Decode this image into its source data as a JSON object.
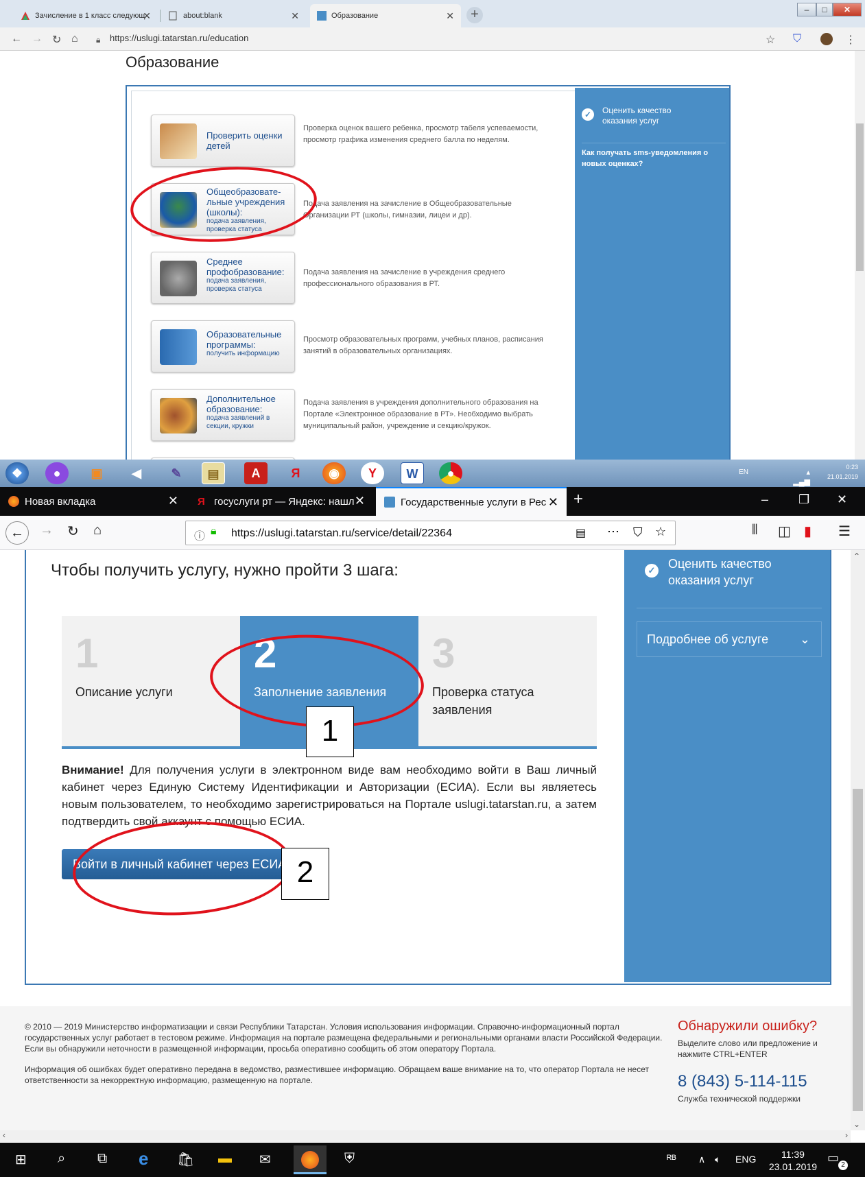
{
  "chrome": {
    "tabs": [
      {
        "label": "Зачисление в 1 класс следующ"
      },
      {
        "label": "about:blank"
      },
      {
        "label": "Образование"
      }
    ],
    "new_tab": "+",
    "url": "https://uslugi.tatarstan.ru/education"
  },
  "education": {
    "title": "Образование",
    "rate_label": "Оценить качество оказания услуг",
    "sms_link": "Как получать sms-уведомления о новых оценках?",
    "services": [
      {
        "title": "Проверить оценки детей",
        "sub": "",
        "desc": "Проверка оценок вашего ребенка, просмотр табеля успеваемости, просмотр графика изменения среднего балла по неделям."
      },
      {
        "title": "Общеобразовате-льные учреждения (школы):",
        "sub": "подача заявления, проверка статуса",
        "desc": "Подача заявления на зачисление в Общеобразовательные Организации РТ (школы, гимназии, лицеи и др)."
      },
      {
        "title": "Среднее профобразование:",
        "sub": "подача заявления, проверка статуса",
        "desc": "Подача заявления на зачисление в учреждения среднего профессионального образования в РТ."
      },
      {
        "title": "Образовательные программы:",
        "sub": "получить информацию",
        "desc": "Просмотр образовательных программ, учебных планов, расписания занятий в образовательных организациях."
      },
      {
        "title": "Дополнительное образование:",
        "sub": "подача заявлений в секции, кружки",
        "desc": "Подача заявления в учреждения дополнительного образования на Портале «Электронное образование в РТ». Необходимо выбрать муниципальный район, учреждение и секцию/кружок."
      }
    ]
  },
  "win7": {
    "lang": "EN",
    "time": "0:23",
    "date": "21.01.2019"
  },
  "firefox": {
    "tabs": [
      {
        "label": "Новая вкладка"
      },
      {
        "label": "госуслуги рт — Яндекс: нашл"
      },
      {
        "label": "Государственные услуги в Рес"
      }
    ],
    "new_tab": "+",
    "url": "https://uslugi.tatarstan.ru/service/detail/22364"
  },
  "service": {
    "heading": "Чтобы получить услугу, нужно пройти 3 шага:",
    "steps": [
      {
        "num": "1",
        "label": "Описание услуги"
      },
      {
        "num": "2",
        "label": "Заполнение заявления"
      },
      {
        "num": "3",
        "label": "Проверка статуса заявления"
      }
    ],
    "warning_bold": "Внимание!",
    "warning_text": " Для получения услуги в электронном виде вам необходимо войти в Ваш личный кабинет через Единую Систему Идентификации и Авторизации (ЕСИА). Если вы являетесь новым пользователем, то необходимо зарегистрироваться на Портале uslugi.tatarstan.ru, а затем подтвердить свой аккаунт с помощью ЕСИА.",
    "esia_button": "Войти в личный кабинет через ЕСИА",
    "rate_label": "Оценить качество оказания услуг",
    "more_label": "Подробнее об услуге"
  },
  "footer": {
    "para1": "© 2010 — 2019 Министерство информатизации и связи Республики Татарстан. Условия использования информации. Справочно-информационный портал государственных услуг работает в тестовом режиме. Информация на портале размещена федеральными и региональными органами власти Российской Федерации. Если вы обнаружили неточности в размещенной информации, просьба оперативно сообщить об этом оператору Портала.",
    "para2": "Информация об ошибках будет оперативно передана в ведомство, разместившее информацию. Обращаем ваше внимание на то, что оператор Портала не несет ответственности за некорректную информацию, размещенную на портале.",
    "error_title": "Обнаружили ошибку?",
    "error_sub": "Выделите слово или предложение и нажмите CTRL+ENTER",
    "phone": "8 (843) 5-114-115",
    "phone_sub": "Служба технической поддержки"
  },
  "win10": {
    "lang": "ENG",
    "time": "11:39",
    "date": "23.01.2019",
    "notif": "2"
  },
  "annotations": {
    "box1": "1",
    "box2": "2"
  },
  "colors": {
    "accent_blue": "#4a8ec6",
    "annotation_red": "#e0121b",
    "error_red": "#c8201a"
  }
}
